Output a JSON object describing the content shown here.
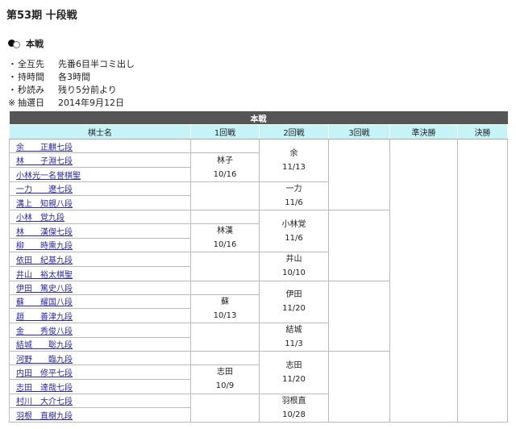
{
  "page": {
    "title": "第53期 十段戦"
  },
  "section": {
    "title": "本戦"
  },
  "rules": [
    {
      "mark": "・",
      "label": "全互先",
      "value": "先番6目半コミ出し"
    },
    {
      "mark": "・",
      "label": "持時間",
      "value": "各3時間"
    },
    {
      "mark": "・",
      "label": "秒読み",
      "value": "残り5分前より"
    },
    {
      "mark": "※",
      "label": "抽選日",
      "value": "2014年9月12日"
    }
  ],
  "table": {
    "caption": "本戦",
    "headers": [
      "棋士名",
      "1回戦",
      "2回戦",
      "3回戦",
      "準決勝",
      "決勝"
    ],
    "players": [
      "余　　正麒七段",
      "林　　子淵七段",
      "小林光一名誉棋聖",
      "一力　　遼七段",
      "溝上　知親八段",
      "小林　覚九段",
      "林　　漢傑七段",
      "柳　　時熏九段",
      "依田　紀基九段",
      "井山　裕太棋聖",
      "伊田　篤史八段",
      "蘇　　耀国八段",
      "趙　　善津九段",
      "金　　秀俊八段",
      "結城　　聡九段",
      "河野　　臨九段",
      "内田　修平七段",
      "志田　達哉七段",
      "村川　大介七段",
      "羽根　直樹九段"
    ],
    "round1": [
      {
        "winner": "林子",
        "date": "10/16"
      },
      {
        "winner": "林漢",
        "date": "10/16"
      },
      {
        "winner": "蘇",
        "date": "10/13"
      },
      {
        "winner": "志田",
        "date": "10/9"
      }
    ],
    "round2": [
      {
        "winner": "余",
        "date": "11/13"
      },
      {
        "winner": "一力",
        "date": "11/6"
      },
      {
        "winner": "小林覚",
        "date": "11/6"
      },
      {
        "winner": "井山",
        "date": "10/10"
      },
      {
        "winner": "伊田",
        "date": "11/20"
      },
      {
        "winner": "結城",
        "date": "11/3"
      },
      {
        "winner": "志田",
        "date": "11/20"
      },
      {
        "winner": "羽根直",
        "date": "10/28"
      }
    ]
  }
}
